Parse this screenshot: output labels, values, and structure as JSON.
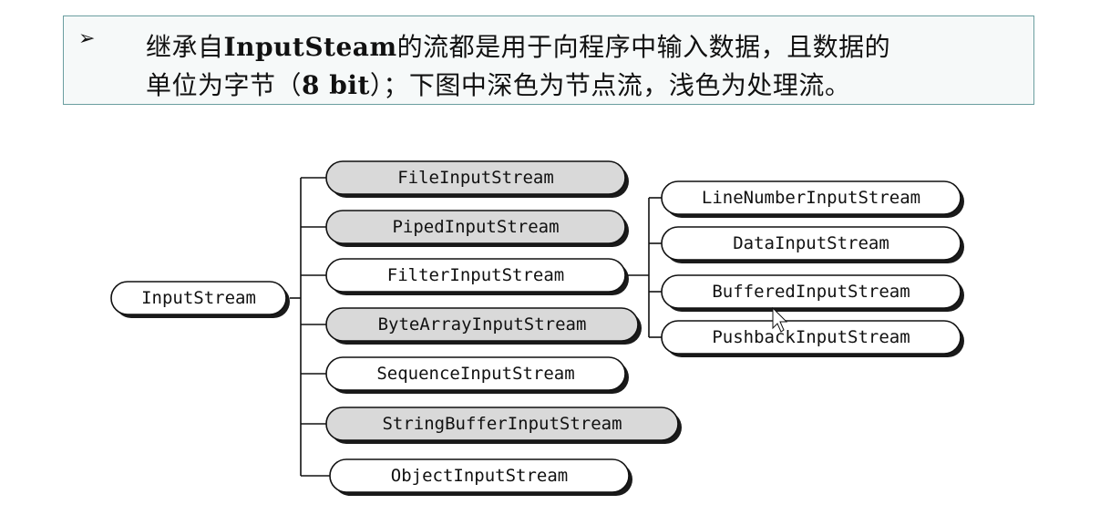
{
  "description_box": {
    "bullet": "➢",
    "line1_pre": "继承自",
    "line1_bold": "InputSteam",
    "line1_post": "的流都是用于向程序中输入数据，且数据的",
    "line2_pre": "单位为字节（",
    "line2_bold": "8 bit",
    "line2_post": "）；下图中深色为节点流，浅色为处理流。"
  },
  "diagram": {
    "root": "InputStream",
    "children": [
      {
        "label": "FileInputStream",
        "kind": "node",
        "fill": "#d9d9d9"
      },
      {
        "label": "PipedInputStream",
        "kind": "node",
        "fill": "#d9d9d9"
      },
      {
        "label": "FilterInputStream",
        "kind": "processing",
        "fill": "#ffffff"
      },
      {
        "label": "ByteArrayInputStream",
        "kind": "node",
        "fill": "#d9d9d9"
      },
      {
        "label": "SequenceInputStream",
        "kind": "processing",
        "fill": "#ffffff"
      },
      {
        "label": "StringBufferInputStream",
        "kind": "node",
        "fill": "#d9d9d9"
      },
      {
        "label": "ObjectInputStream",
        "kind": "processing",
        "fill": "#ffffff"
      }
    ],
    "filter_children": [
      {
        "label": "LineNumberInputStream",
        "kind": "processing",
        "fill": "#ffffff"
      },
      {
        "label": "DataInputStream",
        "kind": "processing",
        "fill": "#ffffff"
      },
      {
        "label": "BufferedInputStream",
        "kind": "processing",
        "fill": "#ffffff"
      },
      {
        "label": "PushbackInputStream",
        "kind": "processing",
        "fill": "#ffffff"
      }
    ]
  }
}
